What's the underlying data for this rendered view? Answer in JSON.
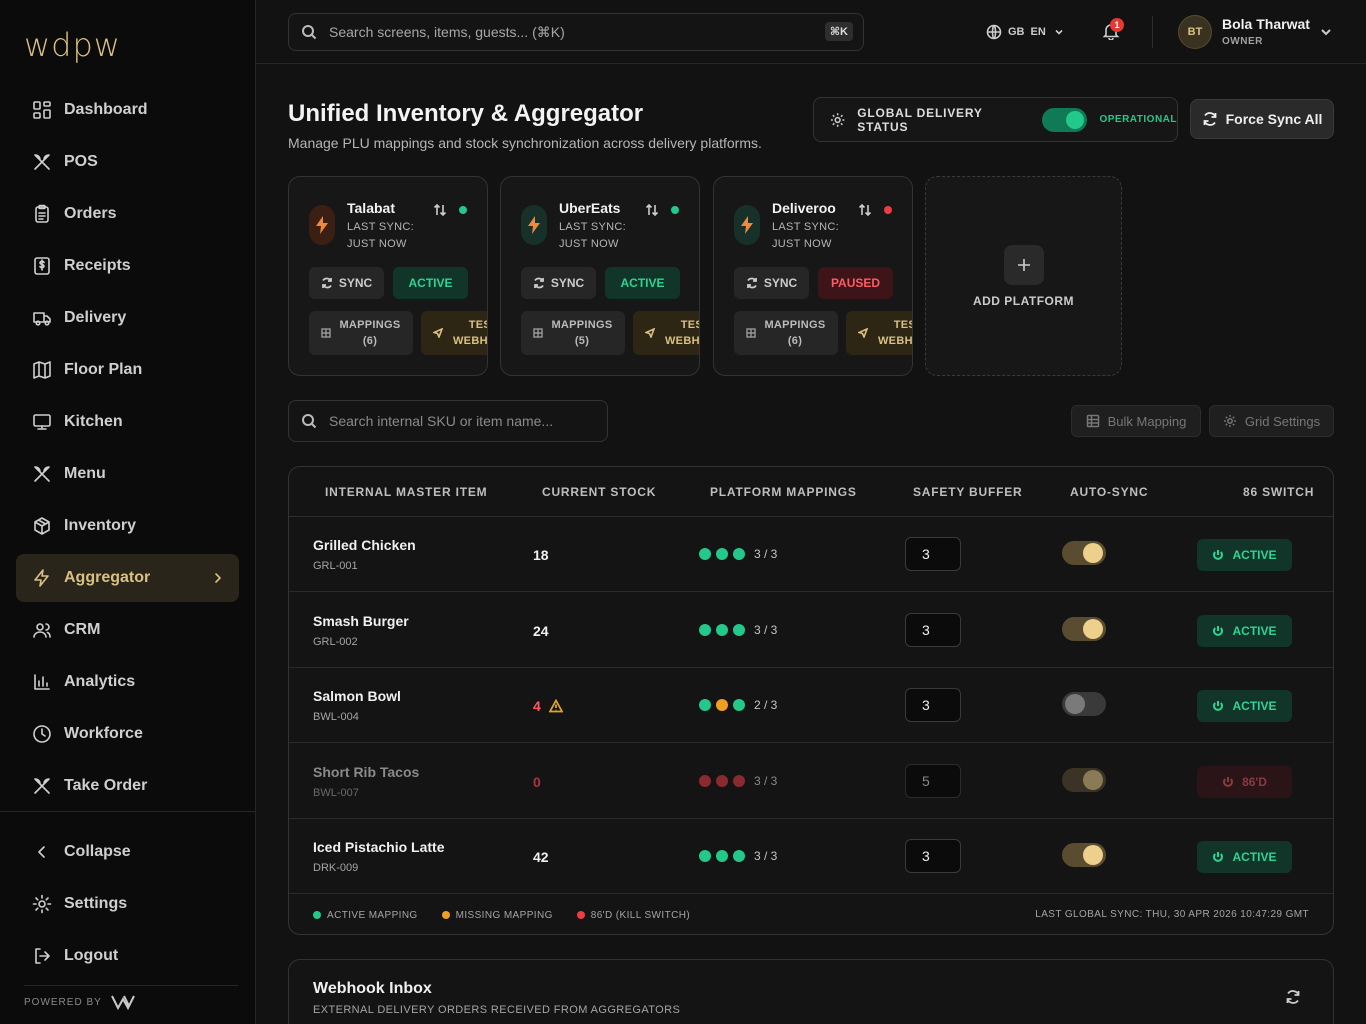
{
  "app": {
    "logo": "wdpw",
    "powered_by": "POWERED BY"
  },
  "sidebar": {
    "items": [
      {
        "label": "Dashboard",
        "icon": "dashboard-icon"
      },
      {
        "label": "POS",
        "icon": "utensils-icon"
      },
      {
        "label": "Orders",
        "icon": "clipboard-icon"
      },
      {
        "label": "Receipts",
        "icon": "receipt-icon"
      },
      {
        "label": "Delivery",
        "icon": "truck-icon"
      },
      {
        "label": "Floor Plan",
        "icon": "map-icon"
      },
      {
        "label": "Kitchen",
        "icon": "monitor-icon"
      },
      {
        "label": "Menu",
        "icon": "utensils-icon"
      },
      {
        "label": "Inventory",
        "icon": "box-icon"
      },
      {
        "label": "Aggregator",
        "icon": "zap-icon",
        "active": true
      },
      {
        "label": "CRM",
        "icon": "users-icon"
      },
      {
        "label": "Analytics",
        "icon": "bar-chart-icon"
      },
      {
        "label": "Workforce",
        "icon": "clock-icon"
      },
      {
        "label": "Take Order",
        "icon": "utensils-icon"
      }
    ],
    "bottom": [
      {
        "label": "Collapse",
        "icon": "chevron-left-icon"
      },
      {
        "label": "Settings",
        "icon": "gear-icon"
      },
      {
        "label": "Logout",
        "icon": "logout-icon"
      }
    ]
  },
  "topbar": {
    "search_placeholder": "Search screens, items, guests... (⌘K)",
    "shortcut": "⌘K",
    "region": "GB",
    "language": "EN",
    "notifications": "1",
    "user": {
      "initials": "BT",
      "name": "Bola Tharwat",
      "role": "OWNER"
    }
  },
  "page": {
    "title": "Unified Inventory & Aggregator",
    "subtitle": "Manage PLU mappings and stock synchronization across delivery platforms.",
    "global_status_label": "GLOBAL DELIVERY STATUS",
    "global_status_value": "OPERATIONAL",
    "force_sync_label": "Force Sync All"
  },
  "platforms": [
    {
      "name": "Talabat",
      "last_sync_label": "LAST SYNC:",
      "last_sync": "JUST NOW",
      "status": "ACTIVE",
      "status_dot": "#22c98a",
      "sync_label": "SYNC",
      "mappings_label": "MAPPINGS",
      "mappings_count": "(6)",
      "test_label_1": "TEST",
      "test_label_2": "WEBHOOK"
    },
    {
      "name": "UberEats",
      "last_sync_label": "LAST SYNC:",
      "last_sync": "JUST NOW",
      "status": "ACTIVE",
      "status_dot": "#22c98a",
      "sync_label": "SYNC",
      "mappings_label": "MAPPINGS",
      "mappings_count": "(5)",
      "test_label_1": "TEST",
      "test_label_2": "WEBHOOK"
    },
    {
      "name": "Deliveroo",
      "last_sync_label": "LAST SYNC:",
      "last_sync": "JUST NOW",
      "status": "PAUSED",
      "status_dot": "#ef3b45",
      "sync_label": "SYNC",
      "mappings_label": "MAPPINGS",
      "mappings_count": "(6)",
      "test_label_1": "TEST",
      "test_label_2": "WEBHOOK"
    }
  ],
  "add_platform_label": "ADD PLATFORM",
  "grid_tools": {
    "search_placeholder": "Search internal SKU or item name...",
    "bulk_mapping": "Bulk Mapping",
    "grid_settings": "Grid Settings"
  },
  "table": {
    "headers": [
      "INTERNAL MASTER ITEM",
      "CURRENT STOCK",
      "PLATFORM MAPPINGS",
      "SAFETY BUFFER",
      "AUTO-SYNC",
      "86 SWITCH"
    ],
    "rows": [
      {
        "name": "Grilled Chicken",
        "sku": "GRL-001",
        "stock": "18",
        "stock_color": "#f0f0f0",
        "warn": false,
        "dots": [
          "#22c98a",
          "#22c98a",
          "#22c98a"
        ],
        "mapping": "3 / 3",
        "buffer": "3",
        "autosync": true,
        "switch": "ACTIVE",
        "killed": false
      },
      {
        "name": "Smash Burger",
        "sku": "GRL-002",
        "stock": "24",
        "stock_color": "#f0f0f0",
        "warn": false,
        "dots": [
          "#22c98a",
          "#22c98a",
          "#22c98a"
        ],
        "mapping": "3 / 3",
        "buffer": "3",
        "autosync": true,
        "switch": "ACTIVE",
        "killed": false
      },
      {
        "name": "Salmon Bowl",
        "sku": "BWL-004",
        "stock": "4",
        "stock_color": "#ff5a64",
        "warn": true,
        "dots": [
          "#22c98a",
          "#f0a020",
          "#22c98a"
        ],
        "mapping": "2 / 3",
        "buffer": "3",
        "autosync": false,
        "switch": "ACTIVE",
        "killed": false
      },
      {
        "name": "Short Rib Tacos",
        "sku": "BWL-007",
        "stock": "0",
        "stock_color": "#a8363e",
        "warn": false,
        "dots": [
          "#8a2a30",
          "#8a2a30",
          "#8a2a30"
        ],
        "mapping": "3 / 3",
        "buffer": "5",
        "autosync": true,
        "switch": "86'D",
        "killed": true
      },
      {
        "name": "Iced Pistachio Latte",
        "sku": "DRK-009",
        "stock": "42",
        "stock_color": "#f0f0f0",
        "warn": false,
        "dots": [
          "#22c98a",
          "#22c98a",
          "#22c98a"
        ],
        "mapping": "3 / 3",
        "buffer": "3",
        "autosync": true,
        "switch": "ACTIVE",
        "killed": false
      }
    ],
    "legend": [
      {
        "label": "ACTIVE MAPPING",
        "color": "#22c98a"
      },
      {
        "label": "MISSING MAPPING",
        "color": "#f0a020"
      },
      {
        "label": "86'D (KILL SWITCH)",
        "color": "#ef3b45"
      }
    ],
    "last_sync": "LAST GLOBAL SYNC: THU, 30 APR 2026 10:47:29 GMT"
  },
  "inbox": {
    "title": "Webhook Inbox",
    "subtitle": "EXTERNAL DELIVERY ORDERS RECEIVED FROM AGGREGATORS"
  }
}
